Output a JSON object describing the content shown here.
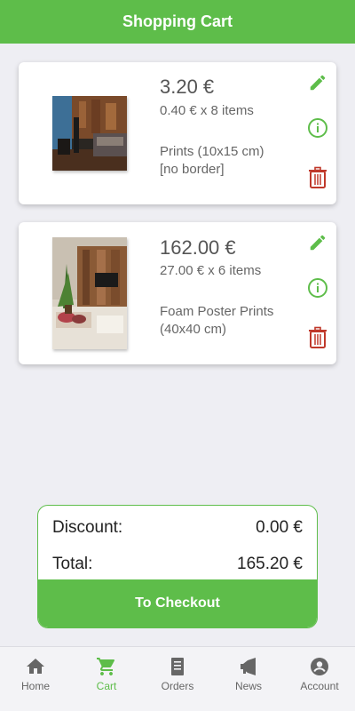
{
  "app": {
    "title": "Shopping Cart"
  },
  "colors": {
    "accent": "#5ebd4a",
    "delete": "#c0392b",
    "text": "#555555"
  },
  "cart_items": [
    {
      "price": "3.20 €",
      "unit_line": "0.40 € x 8 items",
      "product_line1": "Prints (10x15 cm)",
      "product_line2": "[no border]",
      "actions": [
        "pencil-icon",
        "info-icon",
        "trash-icon"
      ]
    },
    {
      "price": "162.00 €",
      "unit_line": "27.00 € x 6 items",
      "product_line1": "Foam Poster Prints",
      "product_line2": "(40x40 cm)",
      "actions": [
        "pencil-icon",
        "info-icon",
        "trash-icon"
      ]
    }
  ],
  "summary": {
    "discount_label": "Discount:",
    "discount_value": "0.00 €",
    "total_label": "Total:",
    "total_value": "165.20 €",
    "checkout_label": "To Checkout"
  },
  "bottom_nav": [
    {
      "label": "Home",
      "icon": "home-icon",
      "active": false
    },
    {
      "label": "Cart",
      "icon": "cart-icon",
      "active": true
    },
    {
      "label": "Orders",
      "icon": "orders-icon",
      "active": false
    },
    {
      "label": "News",
      "icon": "megaphone-icon",
      "active": false
    },
    {
      "label": "Account",
      "icon": "account-icon",
      "active": false
    }
  ]
}
